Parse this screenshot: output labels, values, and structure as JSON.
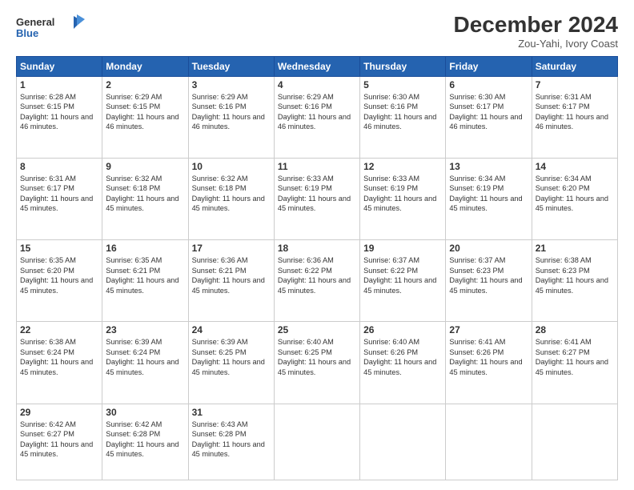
{
  "header": {
    "logo_line1": "General",
    "logo_line2": "Blue",
    "month_title": "December 2024",
    "subtitle": "Zou-Yahi, Ivory Coast"
  },
  "days_of_week": [
    "Sunday",
    "Monday",
    "Tuesday",
    "Wednesday",
    "Thursday",
    "Friday",
    "Saturday"
  ],
  "weeks": [
    [
      {
        "day": "1",
        "sunrise": "6:28 AM",
        "sunset": "6:15 PM",
        "daylight": "11 hours and 46 minutes."
      },
      {
        "day": "2",
        "sunrise": "6:29 AM",
        "sunset": "6:15 PM",
        "daylight": "11 hours and 46 minutes."
      },
      {
        "day": "3",
        "sunrise": "6:29 AM",
        "sunset": "6:16 PM",
        "daylight": "11 hours and 46 minutes."
      },
      {
        "day": "4",
        "sunrise": "6:29 AM",
        "sunset": "6:16 PM",
        "daylight": "11 hours and 46 minutes."
      },
      {
        "day": "5",
        "sunrise": "6:30 AM",
        "sunset": "6:16 PM",
        "daylight": "11 hours and 46 minutes."
      },
      {
        "day": "6",
        "sunrise": "6:30 AM",
        "sunset": "6:17 PM",
        "daylight": "11 hours and 46 minutes."
      },
      {
        "day": "7",
        "sunrise": "6:31 AM",
        "sunset": "6:17 PM",
        "daylight": "11 hours and 46 minutes."
      }
    ],
    [
      {
        "day": "8",
        "sunrise": "6:31 AM",
        "sunset": "6:17 PM",
        "daylight": "11 hours and 45 minutes."
      },
      {
        "day": "9",
        "sunrise": "6:32 AM",
        "sunset": "6:18 PM",
        "daylight": "11 hours and 45 minutes."
      },
      {
        "day": "10",
        "sunrise": "6:32 AM",
        "sunset": "6:18 PM",
        "daylight": "11 hours and 45 minutes."
      },
      {
        "day": "11",
        "sunrise": "6:33 AM",
        "sunset": "6:19 PM",
        "daylight": "11 hours and 45 minutes."
      },
      {
        "day": "12",
        "sunrise": "6:33 AM",
        "sunset": "6:19 PM",
        "daylight": "11 hours and 45 minutes."
      },
      {
        "day": "13",
        "sunrise": "6:34 AM",
        "sunset": "6:19 PM",
        "daylight": "11 hours and 45 minutes."
      },
      {
        "day": "14",
        "sunrise": "6:34 AM",
        "sunset": "6:20 PM",
        "daylight": "11 hours and 45 minutes."
      }
    ],
    [
      {
        "day": "15",
        "sunrise": "6:35 AM",
        "sunset": "6:20 PM",
        "daylight": "11 hours and 45 minutes."
      },
      {
        "day": "16",
        "sunrise": "6:35 AM",
        "sunset": "6:21 PM",
        "daylight": "11 hours and 45 minutes."
      },
      {
        "day": "17",
        "sunrise": "6:36 AM",
        "sunset": "6:21 PM",
        "daylight": "11 hours and 45 minutes."
      },
      {
        "day": "18",
        "sunrise": "6:36 AM",
        "sunset": "6:22 PM",
        "daylight": "11 hours and 45 minutes."
      },
      {
        "day": "19",
        "sunrise": "6:37 AM",
        "sunset": "6:22 PM",
        "daylight": "11 hours and 45 minutes."
      },
      {
        "day": "20",
        "sunrise": "6:37 AM",
        "sunset": "6:23 PM",
        "daylight": "11 hours and 45 minutes."
      },
      {
        "day": "21",
        "sunrise": "6:38 AM",
        "sunset": "6:23 PM",
        "daylight": "11 hours and 45 minutes."
      }
    ],
    [
      {
        "day": "22",
        "sunrise": "6:38 AM",
        "sunset": "6:24 PM",
        "daylight": "11 hours and 45 minutes."
      },
      {
        "day": "23",
        "sunrise": "6:39 AM",
        "sunset": "6:24 PM",
        "daylight": "11 hours and 45 minutes."
      },
      {
        "day": "24",
        "sunrise": "6:39 AM",
        "sunset": "6:25 PM",
        "daylight": "11 hours and 45 minutes."
      },
      {
        "day": "25",
        "sunrise": "6:40 AM",
        "sunset": "6:25 PM",
        "daylight": "11 hours and 45 minutes."
      },
      {
        "day": "26",
        "sunrise": "6:40 AM",
        "sunset": "6:26 PM",
        "daylight": "11 hours and 45 minutes."
      },
      {
        "day": "27",
        "sunrise": "6:41 AM",
        "sunset": "6:26 PM",
        "daylight": "11 hours and 45 minutes."
      },
      {
        "day": "28",
        "sunrise": "6:41 AM",
        "sunset": "6:27 PM",
        "daylight": "11 hours and 45 minutes."
      }
    ],
    [
      {
        "day": "29",
        "sunrise": "6:42 AM",
        "sunset": "6:27 PM",
        "daylight": "11 hours and 45 minutes."
      },
      {
        "day": "30",
        "sunrise": "6:42 AM",
        "sunset": "6:28 PM",
        "daylight": "11 hours and 45 minutes."
      },
      {
        "day": "31",
        "sunrise": "6:43 AM",
        "sunset": "6:28 PM",
        "daylight": "11 hours and 45 minutes."
      },
      null,
      null,
      null,
      null
    ]
  ]
}
